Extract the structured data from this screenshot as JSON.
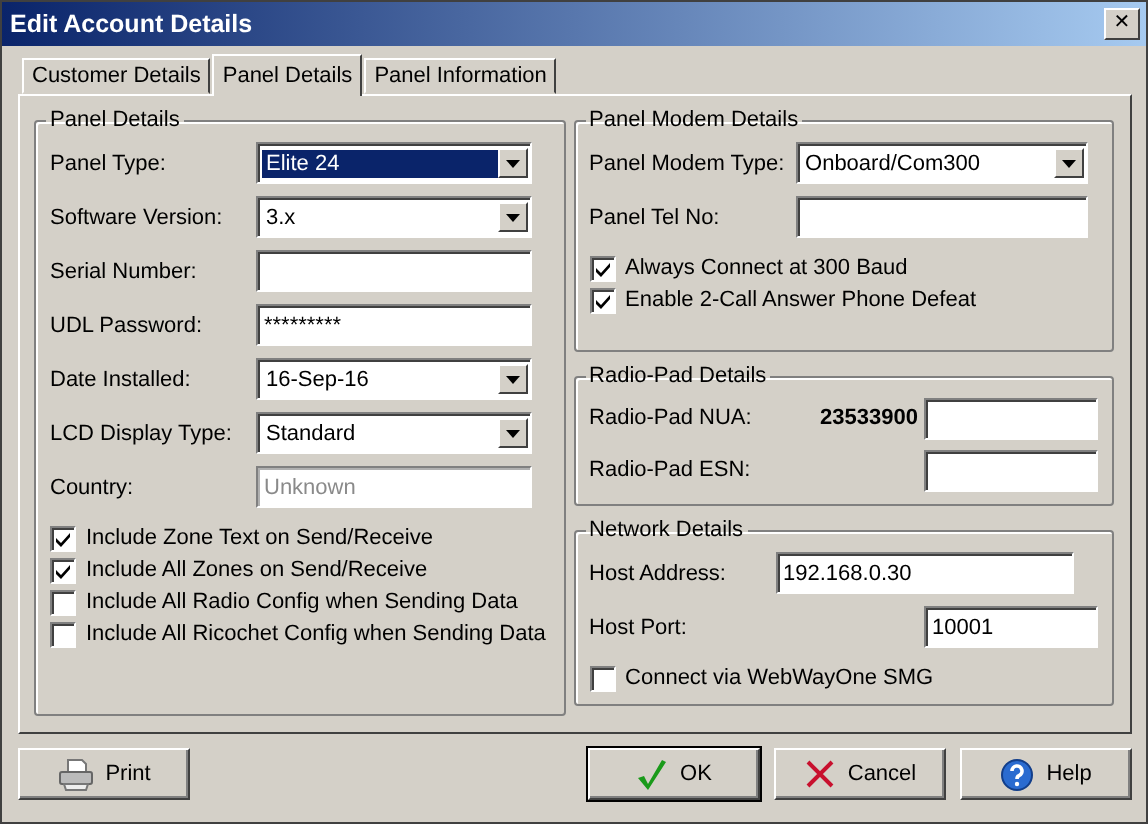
{
  "window": {
    "title": "Edit Account Details",
    "close": "✕"
  },
  "tabs": [
    {
      "label": "Customer Details",
      "selected": false
    },
    {
      "label": "Panel Details",
      "selected": true
    },
    {
      "label": "Panel Information",
      "selected": false
    }
  ],
  "panel_details": {
    "title": "Panel Details",
    "fields": [
      {
        "label": "Panel Type:",
        "kind": "select",
        "value": "Elite 24",
        "focused": true
      },
      {
        "label": "Software Version:",
        "kind": "select",
        "value": "3.x",
        "focused": false
      },
      {
        "label": "Serial Number:",
        "kind": "input",
        "disabled": false
      },
      {
        "label": "UDL Password:",
        "kind": "input",
        "value": "*********",
        "disabled": false
      },
      {
        "label": "Date Installed:",
        "kind": "select",
        "value": "16-Sep-16",
        "focused": false
      },
      {
        "label": "LCD Display Type:",
        "kind": "select",
        "value": "Standard",
        "focused": false
      },
      {
        "label": "Country:",
        "kind": "input",
        "value": "Unknown",
        "disabled": true
      }
    ],
    "options": [
      {
        "label": "Include Zone Text on Send/Receive",
        "checked": true
      },
      {
        "label": "Include All Zones on Send/Receive",
        "checked": true
      },
      {
        "label": "Include All Radio Config when Sending Data",
        "checked": false
      },
      {
        "label": "Include All Ricochet Config when Sending Data",
        "checked": false
      }
    ]
  },
  "panel_modem_details": {
    "title": "Panel Modem Details",
    "fields": [
      {
        "label": "Panel Modem Type:",
        "kind": "select",
        "value": "Onboard/Com300"
      },
      {
        "label": "Panel Tel No:",
        "kind": "input"
      }
    ],
    "options": [
      {
        "label": "Always Connect at 300 Baud",
        "checked": true
      },
      {
        "label": "Enable 2-Call Answer Phone Defeat",
        "checked": true
      }
    ]
  },
  "radio_pad_details": {
    "title": "Radio-Pad Details",
    "fields": [
      {
        "label": "Radio-Pad NUA:",
        "kind": "input",
        "code": "23533900"
      },
      {
        "label": "Radio-Pad ESN:",
        "kind": "input"
      }
    ]
  },
  "network_details": {
    "title": "Network Details",
    "fields": [
      {
        "label": "Host Address:",
        "kind": "input",
        "value": "192.168.0.30"
      },
      {
        "label": "Host Port:",
        "kind": "input",
        "value": "10001"
      }
    ],
    "options": [
      {
        "label": "Connect via WebWayOne SMG",
        "checked": false
      }
    ]
  },
  "buttons": [
    {
      "label": "Print",
      "kind": "print",
      "default": false
    },
    {
      "label": "OK",
      "kind": "ok",
      "default": true
    },
    {
      "label": "Cancel",
      "kind": "cancel",
      "default": false
    },
    {
      "label": "Help",
      "kind": "help",
      "default": false
    }
  ]
}
